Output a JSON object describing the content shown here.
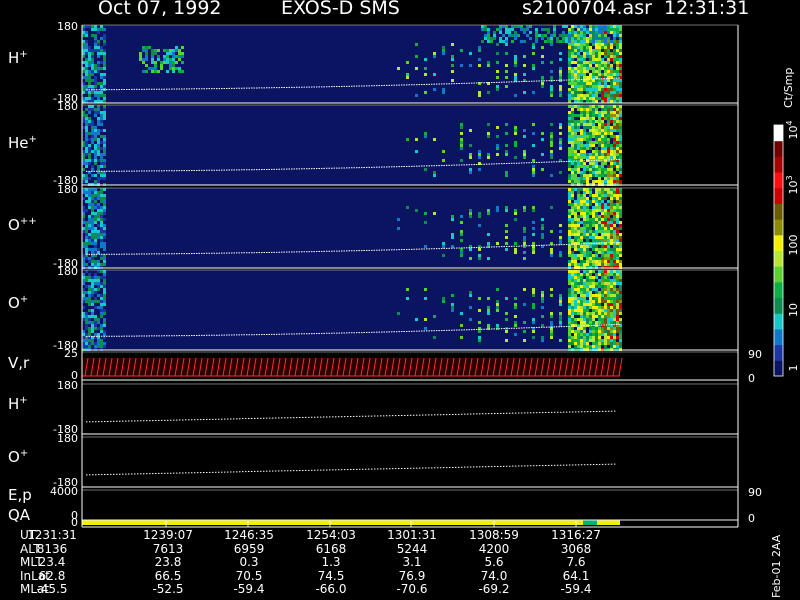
{
  "header": {
    "date": "Oct 07, 1992",
    "instrument": "EXOS-D SMS",
    "filename": "s2100704.asr",
    "time": "12:31:31"
  },
  "colorbar": {
    "unit": "Ct/Smp",
    "ticks": [
      "1",
      "10",
      "100",
      "10",
      "10"
    ],
    "superscripts": [
      "3",
      "4"
    ],
    "colors": [
      "#0b1460",
      "#1a37a6",
      "#0f78c8",
      "#16c8c8",
      "#0c8c50",
      "#0ab046",
      "#5ad232",
      "#b4e632",
      "#f0f000",
      "#8c8c00",
      "#6a5a00",
      "#cc0000",
      "#ff1010",
      "#aa0000",
      "#700000",
      "#ffffff"
    ]
  },
  "chart_data": {
    "type": "heatmap",
    "panels": [
      {
        "label": "H",
        "sup": "+",
        "ylim": [
          "180",
          "-180"
        ],
        "type": "spectrogram"
      },
      {
        "label": "He",
        "sup": "+",
        "ylim": [
          "180",
          "-180"
        ],
        "type": "spectrogram"
      },
      {
        "label": "O",
        "sup": "++",
        "ylim": [
          "180",
          "-180"
        ],
        "type": "spectrogram"
      },
      {
        "label": "O",
        "sup": "+",
        "ylim": [
          "180",
          "-180"
        ],
        "type": "spectrogram"
      },
      {
        "label": "V,r",
        "sup": "",
        "ylim": [
          "25",
          "0"
        ],
        "right_ticks": [
          "90",
          "0"
        ],
        "type": "vector"
      },
      {
        "label": "H",
        "sup": "+",
        "ylim": [
          "180",
          "-180"
        ],
        "type": "line"
      },
      {
        "label": "O",
        "sup": "+",
        "ylim": [
          "180",
          "-180"
        ],
        "type": "line"
      },
      {
        "label": "E,p",
        "sup": "",
        "ylim": [
          "4000",
          "0"
        ],
        "right_ticks": [
          "90",
          "0"
        ],
        "type": "line"
      },
      {
        "label": "QA",
        "sup": "",
        "ylim": [
          "",
          "0"
        ],
        "type": "quality"
      }
    ],
    "times": [
      "1231:31",
      "1239:07",
      "1246:35",
      "1254:03",
      "1301:31",
      "1308:59",
      "1316:27"
    ],
    "table": [
      {
        "name": "UT",
        "values": [
          "1231:31",
          "1239:07",
          "1246:35",
          "1254:03",
          "1301:31",
          "1308:59",
          "1316:27"
        ]
      },
      {
        "name": "ALT",
        "values": [
          "8136",
          "7613",
          "6959",
          "6168",
          "5244",
          "4200",
          "3068"
        ]
      },
      {
        "name": "MLT",
        "values": [
          "23.4",
          "23.8",
          "0.3",
          "1.3",
          "3.1",
          "5.6",
          "7.6"
        ]
      },
      {
        "name": "InLat",
        "values": [
          "62.8",
          "66.5",
          "70.5",
          "74.5",
          "76.9",
          "74.0",
          "64.1"
        ]
      },
      {
        "name": "MLat",
        "values": [
          "-45.5",
          "-52.5",
          "-59.4",
          "-66.0",
          "-70.6",
          "-69.2",
          "-59.4"
        ]
      }
    ]
  },
  "footer": "Feb-01 2AA"
}
